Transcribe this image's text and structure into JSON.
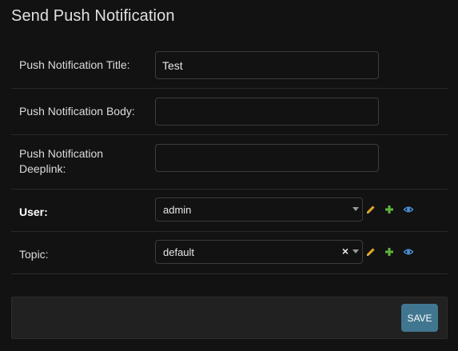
{
  "page": {
    "title": "Send Push Notification"
  },
  "fields": {
    "title": {
      "label": "Push Notification Title:",
      "value": "Test"
    },
    "body": {
      "label": "Push Notification Body:",
      "value": ""
    },
    "deeplink": {
      "label": "Push Notification Deeplink:",
      "value": ""
    },
    "user": {
      "label": "User:",
      "selected": "admin",
      "actions": [
        "pencil-icon",
        "plus-icon",
        "eye-icon"
      ]
    },
    "topic": {
      "label": "Topic:",
      "selected": "default",
      "clear_glyph": "×",
      "actions": [
        "pencil-icon",
        "plus-icon",
        "eye-icon"
      ]
    }
  },
  "footer": {
    "save_label": "SAVE"
  },
  "colors": {
    "background": "#121212",
    "panel": "#212121",
    "accent": "#417690",
    "edit_icon": "#e0a526",
    "add_icon": "#61b23b",
    "view_icon": "#4a90d9"
  }
}
